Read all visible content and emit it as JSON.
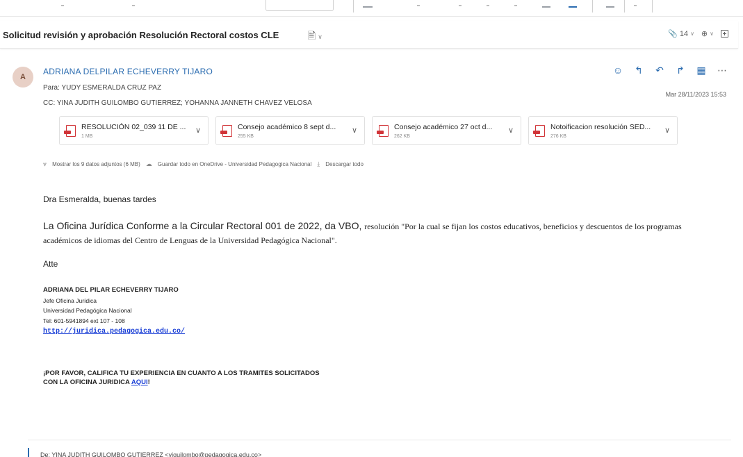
{
  "subject": "Solicitud revisión y aprobación Resolución Rectoral costos CLE",
  "toolbar": {
    "attachment_count": "14",
    "zoom_icon": "zoom-icon",
    "open_icon": "open-in-window-icon"
  },
  "message": {
    "avatar_initial": "A",
    "sender": "ADRIANA DELPILAR ECHEVERRY TIJARO",
    "to_line": "Para:  YUDY ESMERALDA CRUZ PAZ",
    "cc_line": "CC:  YINA JUDITH GUILOMBO GUTIERREZ;  YOHANNA JANNETH CHAVEZ VELOSA",
    "date": "Mar 28/11/2023 15:53"
  },
  "attachments": [
    {
      "name": "RESOLUCIÓN 02_039 11 DE ...",
      "size": "1 MB"
    },
    {
      "name": "Consejo académico 8 sept d...",
      "size": "255 KB"
    },
    {
      "name": "Consejo académico 27 oct d...",
      "size": "262 KB"
    },
    {
      "name": "Notoificacion resolución SED...",
      "size": "276 KB"
    }
  ],
  "attachment_links": {
    "show_all": "Mostrar los 9 datos adjuntos (6 MB)",
    "save_onedrive": "Guardar todo en OneDrive - Universidad Pedagogica Nacional",
    "download_all": "Descargar todo"
  },
  "body": {
    "greeting": "Dra Esmeralda, buenas tardes",
    "para_lead": "La Oficina Jurídica Conforme a la Circular Rectoral 001 de 2022, da VBO,",
    "para_rest": "resolución \"Por la cual se fijan los costos educativos, beneficios y descuentos de los programas académicos de idiomas del Centro de Lenguas de la Universidad Pedagógica Nacional\".",
    "closing": "Atte"
  },
  "signature": {
    "name": "ADRIANA DEL PILAR ECHEVERRY TIJARO",
    "role": "Jefe Oficina Jurídica",
    "org": "Universidad Pedagógica Nacional",
    "tel": "Tel: 601-5941894 ext 107 - 108",
    "link": "http://juridica.pedagogica.edu.co/"
  },
  "cta": {
    "line1": "¡POR FAVOR, CALIFICA TU EXPERIENCIA EN CUANTO A LOS TRAMITES SOLICITADOS",
    "line2_prefix": "CON LA OFICINA JURIDICA ",
    "link": "AQUI",
    "line2_suffix": "!"
  },
  "footer": {
    "text": "De: YINA JUDITH GUILOMBO GUTIERREZ <yjguilombo@pedagogica.edu.co>"
  },
  "colors": {
    "accent": "#2b6cb0",
    "link": "#1a3fd6",
    "pdf_red": "#d13438",
    "avatar_bg": "#e8d0c6"
  }
}
